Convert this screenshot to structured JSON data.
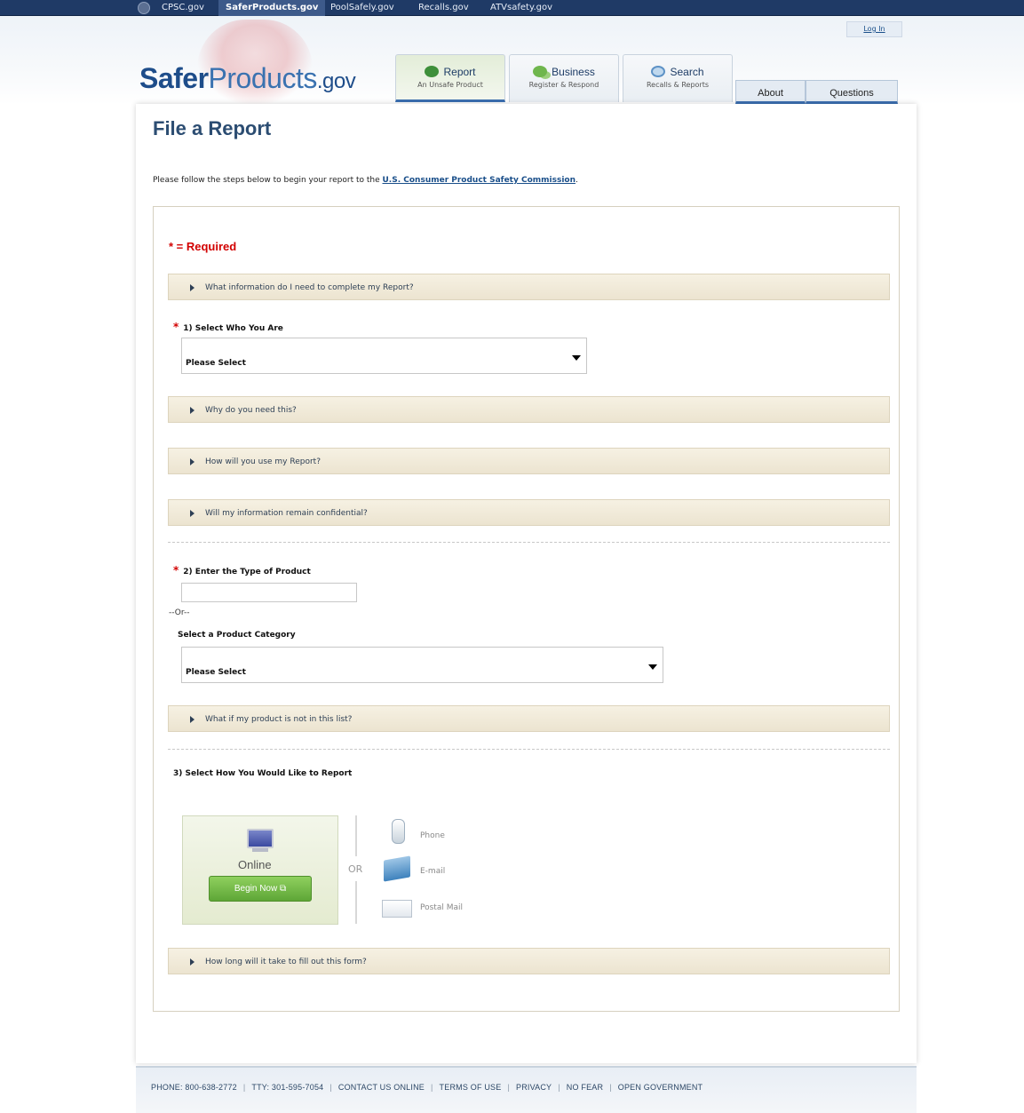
{
  "govbar": {
    "links": [
      "CPSC.gov",
      "SaferProducts.gov",
      "PoolSafely.gov",
      "Recalls.gov",
      "ATVsafety.gov"
    ],
    "active": "SaferProducts.gov"
  },
  "header": {
    "login": "Log In",
    "logo": {
      "part1": "Safer",
      "part2": "Products",
      "part3": ".gov"
    },
    "tabs": [
      {
        "label": "Report",
        "sub": "An Unsafe Product"
      },
      {
        "label": "Business",
        "sub": "Register & Respond"
      },
      {
        "label": "Search",
        "sub": "Recalls & Reports"
      }
    ],
    "small_tabs": [
      "About",
      "Questions"
    ]
  },
  "page": {
    "title": "File a Report",
    "intro_text": "Please follow the steps below to begin your report to the ",
    "intro_link": "U.S. Consumer Product Safety Commission",
    "intro_end": "."
  },
  "form": {
    "required_note": "* = Required",
    "accordion": {
      "what_info": "What information do I need to complete my Report?",
      "why_need": "Why do you need this?",
      "how_use": "How will you use my Report?",
      "confidential": "Will my information remain confidential?",
      "not_in_list": "What if my product is not in this list?",
      "how_long": "How long will it take to fill out this form?"
    },
    "q1_label": "1) Select Who You Are",
    "q1_value": "Please Select",
    "q2_label": "2) Enter the Type of Product",
    "q2_value": "",
    "or_text": "--Or--",
    "category_label": "Select a Product Category",
    "category_value": "Please Select",
    "q3_label": "3) Select How You Would Like to Report",
    "online_label": "Online",
    "begin_button": "Begin Now",
    "or_separator": "OR",
    "methods": {
      "phone": "Phone",
      "email": "E-mail",
      "postal": "Postal Mail"
    }
  },
  "footer": {
    "phone": "PHONE: 800-638-2772",
    "tty": "TTY: 301-595-7054",
    "contact": "CONTACT US ONLINE",
    "terms": "TERMS OF USE",
    "privacy": "PRIVACY",
    "no_fear": "NO FEAR",
    "open_gov": "OPEN GOVERNMENT"
  },
  "colors": {
    "gov_bar": "#1f3a66",
    "title_blue": "#2c4d72",
    "required_red": "#d20000",
    "accordion_bg": "#ece4d0",
    "begin_green": "#5ea637"
  },
  "icons": {
    "seal": "cpsc-seal-icon",
    "report": "speech-bubble-icon",
    "business": "chat-bubbles-icon",
    "search": "magnifier-icon",
    "online": "computer-monitor-icon",
    "external": "external-link-icon",
    "phone": "phone-icon",
    "email": "email-envelope-icon",
    "postal": "postal-envelope-icon",
    "accordion": "triangle-right-icon",
    "select": "caret-down-icon"
  }
}
